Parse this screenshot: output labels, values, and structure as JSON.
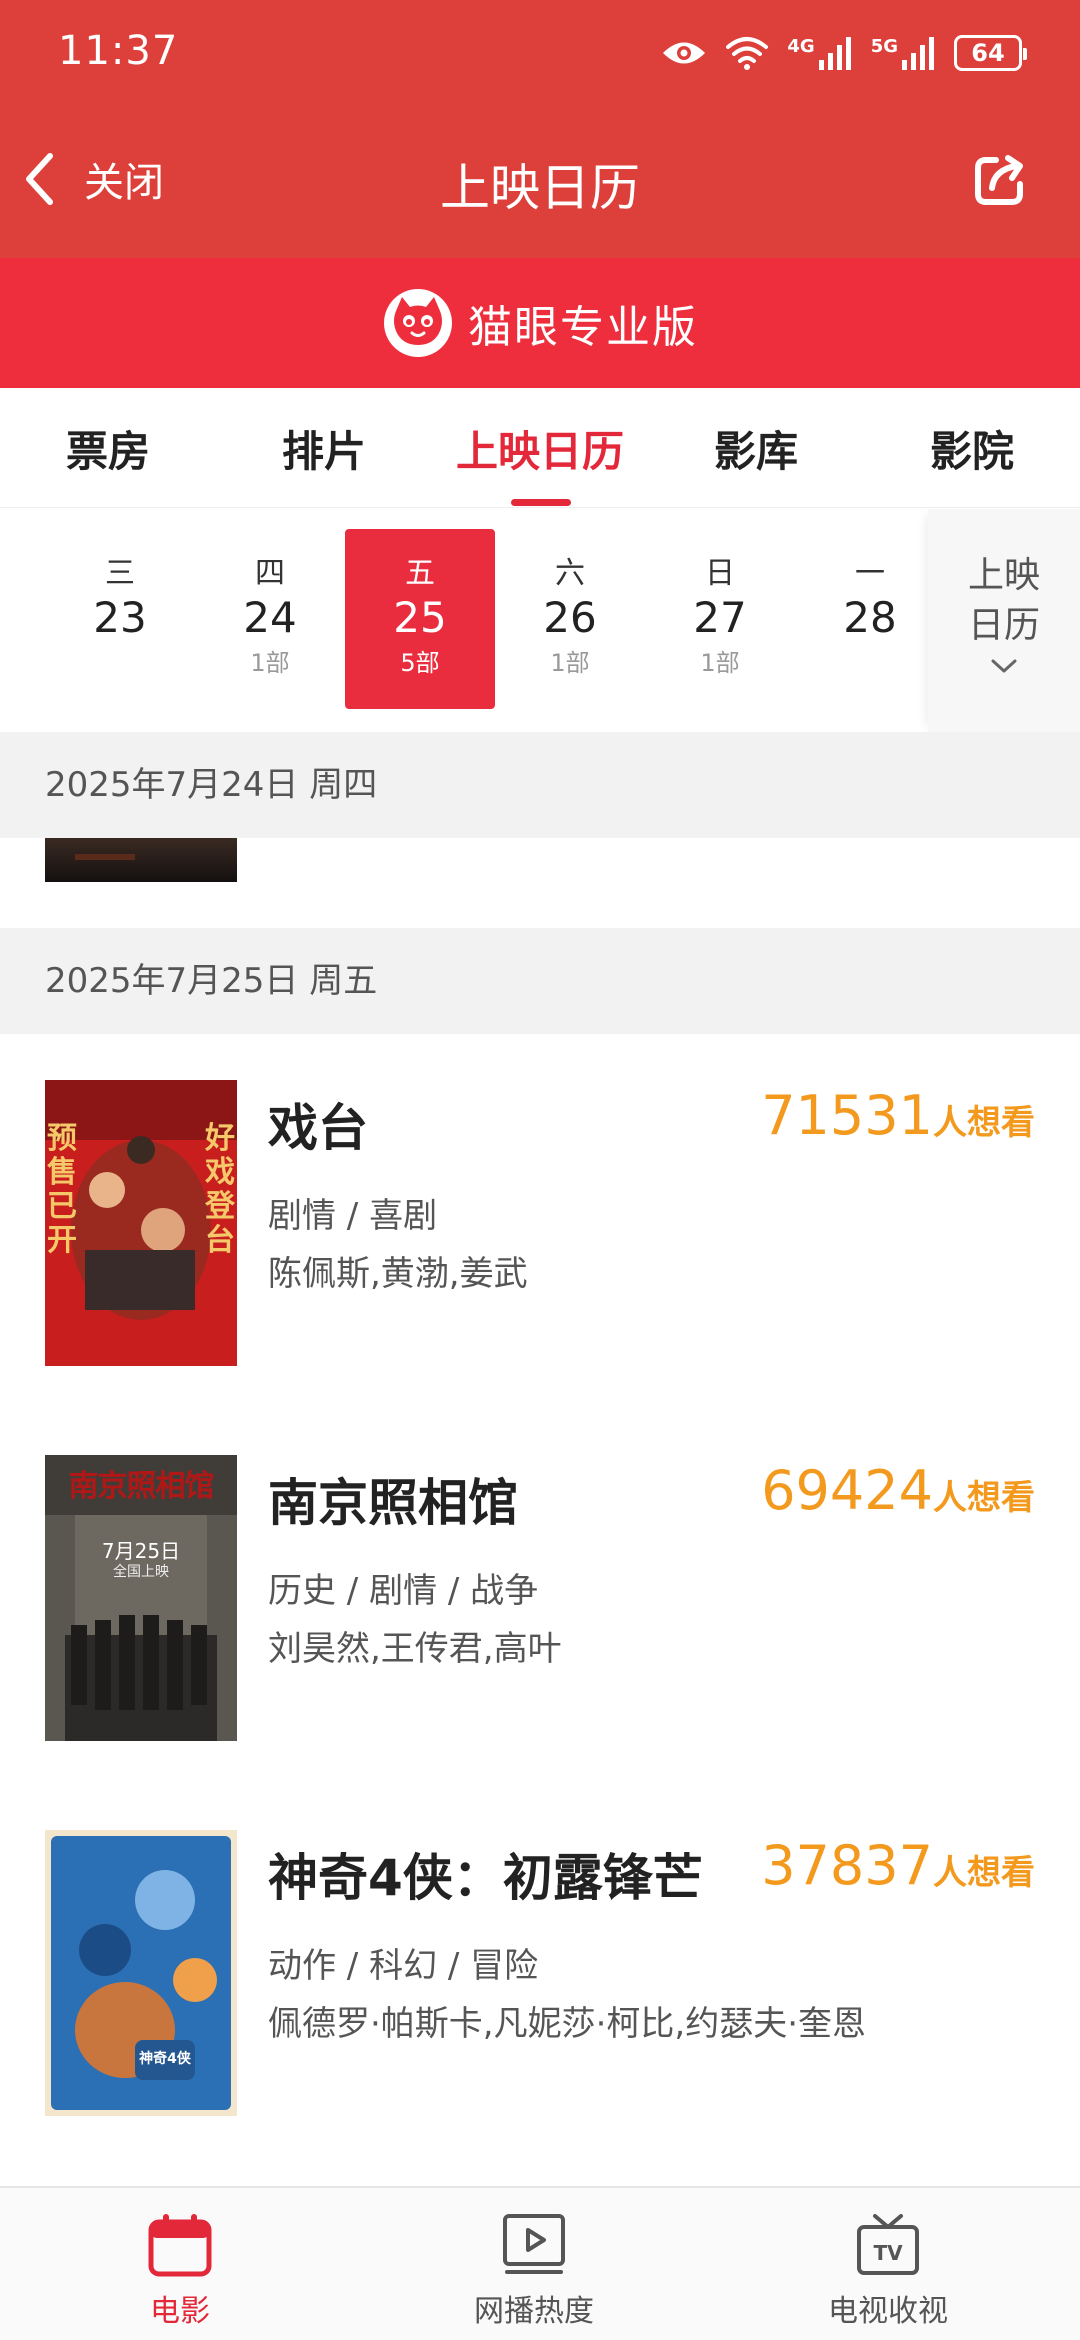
{
  "status_bar": {
    "time": "11:37",
    "battery": "64",
    "net1": "4G",
    "net2": "5G"
  },
  "header": {
    "back_label": "关闭",
    "title": "上映日历"
  },
  "brand": {
    "name": "猫眼专业版"
  },
  "tabs": [
    {
      "label": "票房",
      "active": false
    },
    {
      "label": "排片",
      "active": false
    },
    {
      "label": "上映日历",
      "active": true
    },
    {
      "label": "影库",
      "active": false
    },
    {
      "label": "影院",
      "active": false
    }
  ],
  "dates": [
    {
      "weekday": "三",
      "day": "23",
      "count": ""
    },
    {
      "weekday": "四",
      "day": "24",
      "count": "1部"
    },
    {
      "weekday": "五",
      "day": "25",
      "count": "5部",
      "selected": true
    },
    {
      "weekday": "六",
      "day": "26",
      "count": "1部"
    },
    {
      "weekday": "日",
      "day": "27",
      "count": "1部"
    },
    {
      "weekday": "一",
      "day": "28",
      "count": ""
    }
  ],
  "calendar_toggle": {
    "label": "上映日历"
  },
  "sections": [
    {
      "date_label": "2025年7月24日 周四"
    },
    {
      "date_label": "2025年7月25日 周五"
    }
  ],
  "movies": [
    {
      "title": "戏台",
      "genre": "剧情 / 喜剧",
      "cast": "陈佩斯,黄渤,姜武",
      "want_count": "71531",
      "want_unit": "人想看",
      "poster": {
        "side_left": "预售已开",
        "side_right": "好戏登台"
      }
    },
    {
      "title": "南京照相馆",
      "genre": "历史 / 剧情 / 战争",
      "cast": "刘昊然,王传君,高叶",
      "want_count": "69424",
      "want_unit": "人想看",
      "poster": {
        "top_text": "南京照相馆",
        "date_text": "7月25日",
        "sub_text": "全国上映"
      }
    },
    {
      "title": "神奇4侠：初露锋芒",
      "genre": "动作 / 科幻 / 冒险",
      "cast": "佩德罗·帕斯卡,凡妮莎·柯比,约瑟夫·奎恩",
      "want_count": "37837",
      "want_unit": "人想看",
      "poster": {
        "badge_text": "神奇4侠"
      }
    }
  ],
  "bottom_nav": [
    {
      "label": "电影",
      "icon": "calendar-icon",
      "active": true
    },
    {
      "label": "网播热度",
      "icon": "play-icon",
      "active": false
    },
    {
      "label": "电视收视",
      "icon": "tv-icon",
      "active": false
    }
  ],
  "colors": {
    "header_bg": "#dd403b",
    "brand_bg": "#ee2e3c",
    "accent": "#e3283a",
    "want_orange": "#f39a1e"
  }
}
